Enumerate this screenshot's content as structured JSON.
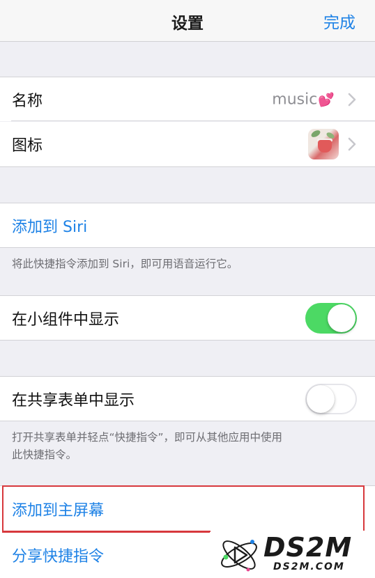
{
  "navbar": {
    "title": "设置",
    "done_label": "完成"
  },
  "rows": {
    "name": {
      "label": "名称",
      "value": "music",
      "value_emoji": "💕"
    },
    "icon": {
      "label": "图标"
    },
    "siri": {
      "label": "添加到 Siri"
    },
    "widget": {
      "label": "在小组件中显示",
      "toggle": "on"
    },
    "share_sheet": {
      "label": "在共享表单中显示",
      "toggle": "off"
    },
    "home_screen": {
      "label": "添加到主屏幕"
    },
    "share": {
      "label": "分享快捷指令"
    }
  },
  "notes": {
    "siri_note": "将此快捷指令添加到 Siri，即可用语音运行它。",
    "share_note_line1": "打开共享表单并轻点“快捷指令”，即可从其他应用中使用",
    "share_note_line2": "此快捷指令。"
  },
  "watermark": {
    "title": "DS2M",
    "subtitle": "DS2M.COM"
  },
  "colors": {
    "accent": "#1e82e6",
    "toggle_on": "#4cd964",
    "highlight": "#d7383c",
    "background": "#efeff4"
  }
}
